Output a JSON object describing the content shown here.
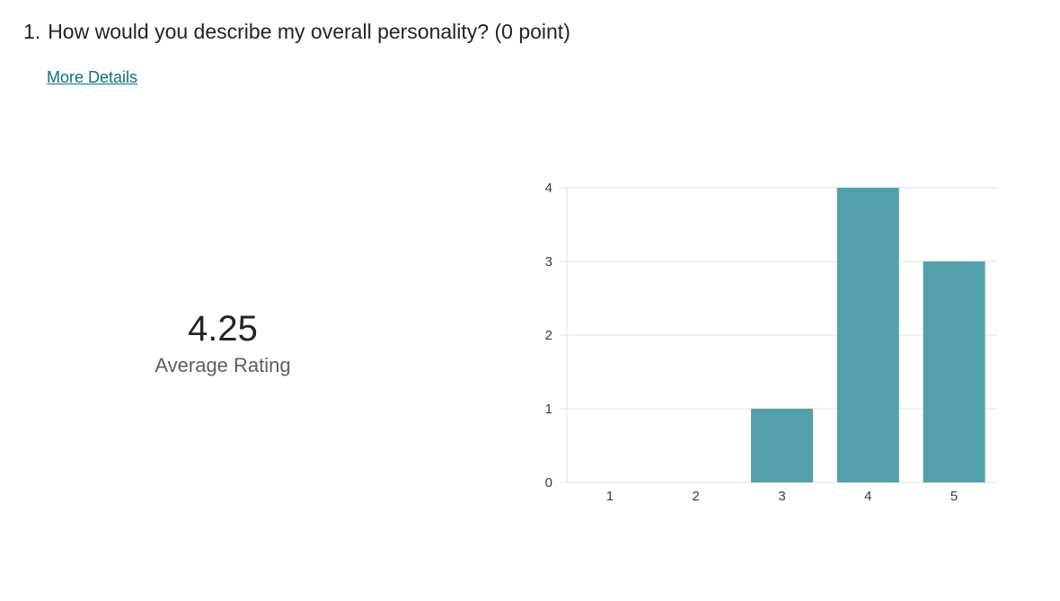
{
  "question": {
    "number": "1.",
    "text": "How would you describe my overall personality? (0 point)"
  },
  "more_details_label": "More Details",
  "summary": {
    "average_value": "4.25",
    "average_label": "Average Rating"
  },
  "colors": {
    "bar": "#52a0ab",
    "link": "#03787c",
    "grid": "#e1dfdd"
  },
  "chart_data": {
    "type": "bar",
    "categories": [
      "1",
      "2",
      "3",
      "4",
      "5"
    ],
    "values": [
      0,
      0,
      1,
      4,
      3
    ],
    "ylim": [
      0,
      4
    ],
    "yticks": [
      0,
      1,
      2,
      3,
      4
    ],
    "grid": true
  }
}
